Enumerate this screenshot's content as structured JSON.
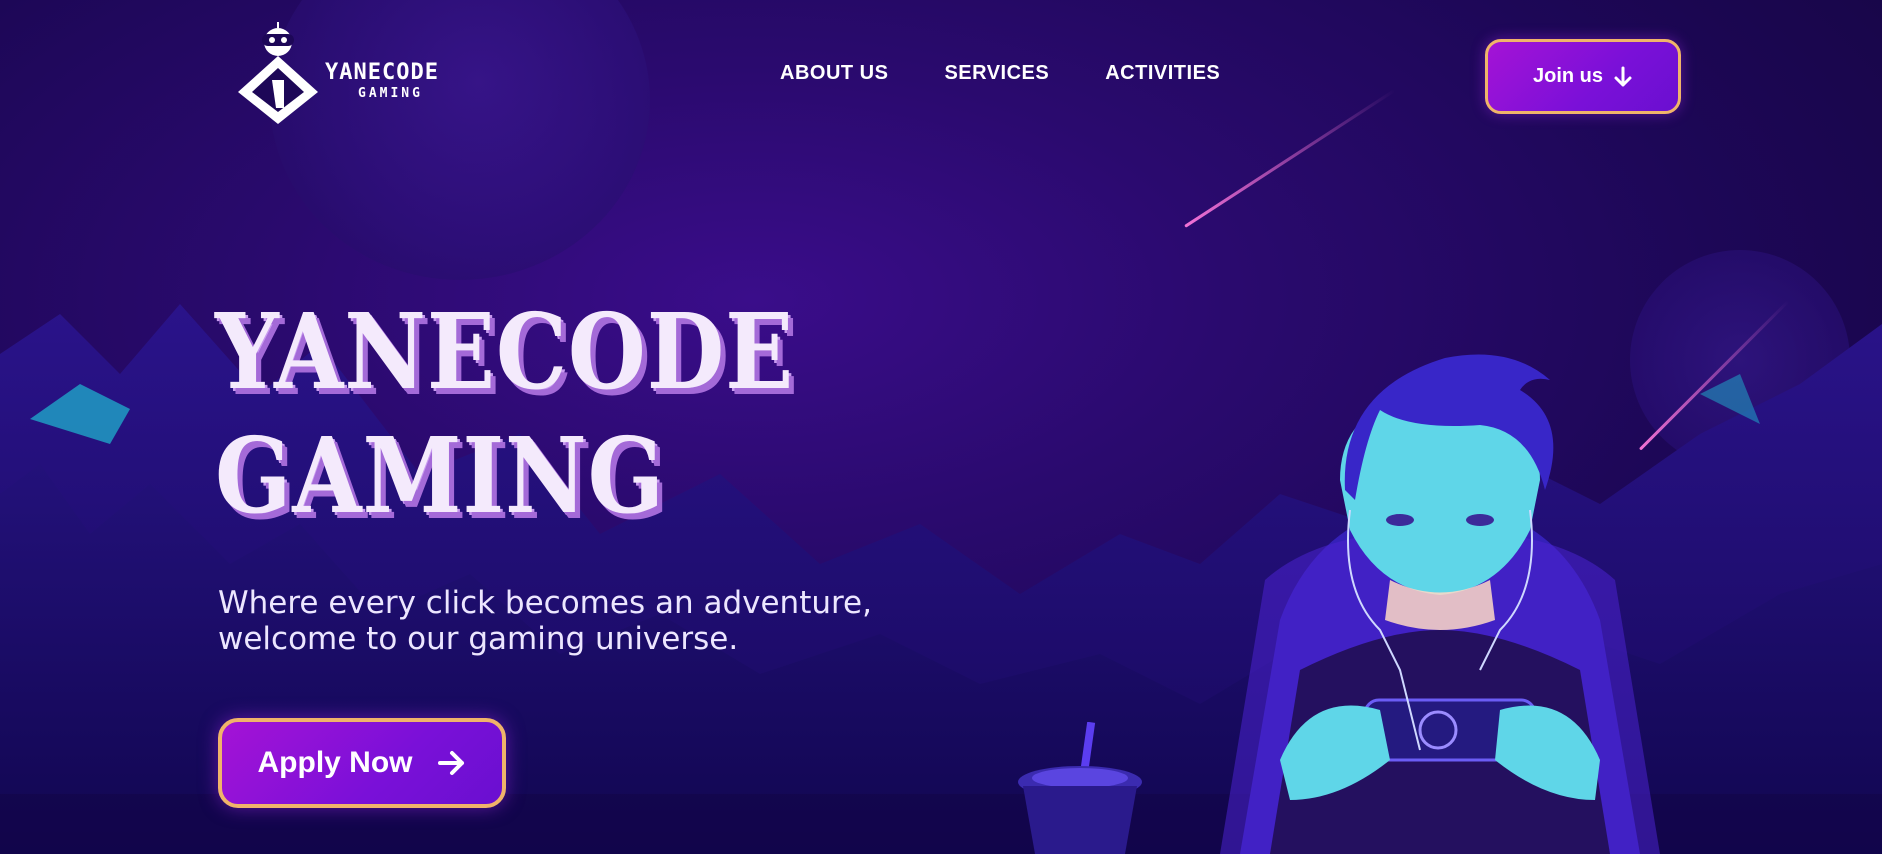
{
  "brand": {
    "logo_main": "YANECODE",
    "logo_sub": "GAMING"
  },
  "nav": {
    "items": [
      {
        "label": "ABOUT US"
      },
      {
        "label": "SERVICES"
      },
      {
        "label": "ACTIVITIES"
      }
    ],
    "cta_label": "Join us",
    "cta_icon": "arrow-down-icon"
  },
  "hero": {
    "title_line1": "YANECODE",
    "title_line2": "GAMING",
    "subtitle_line1": "Where every click becomes an adventure,",
    "subtitle_line2": "welcome to our gaming universe.",
    "cta_label": "Apply Now",
    "cta_icon": "arrow-right-icon"
  },
  "colors": {
    "background": "#1d0757",
    "button_gradient_start": "#a413d6",
    "button_gradient_end": "#6a0fd0",
    "button_border": "#f0b46a",
    "title_shadow": "#a46ad8"
  }
}
